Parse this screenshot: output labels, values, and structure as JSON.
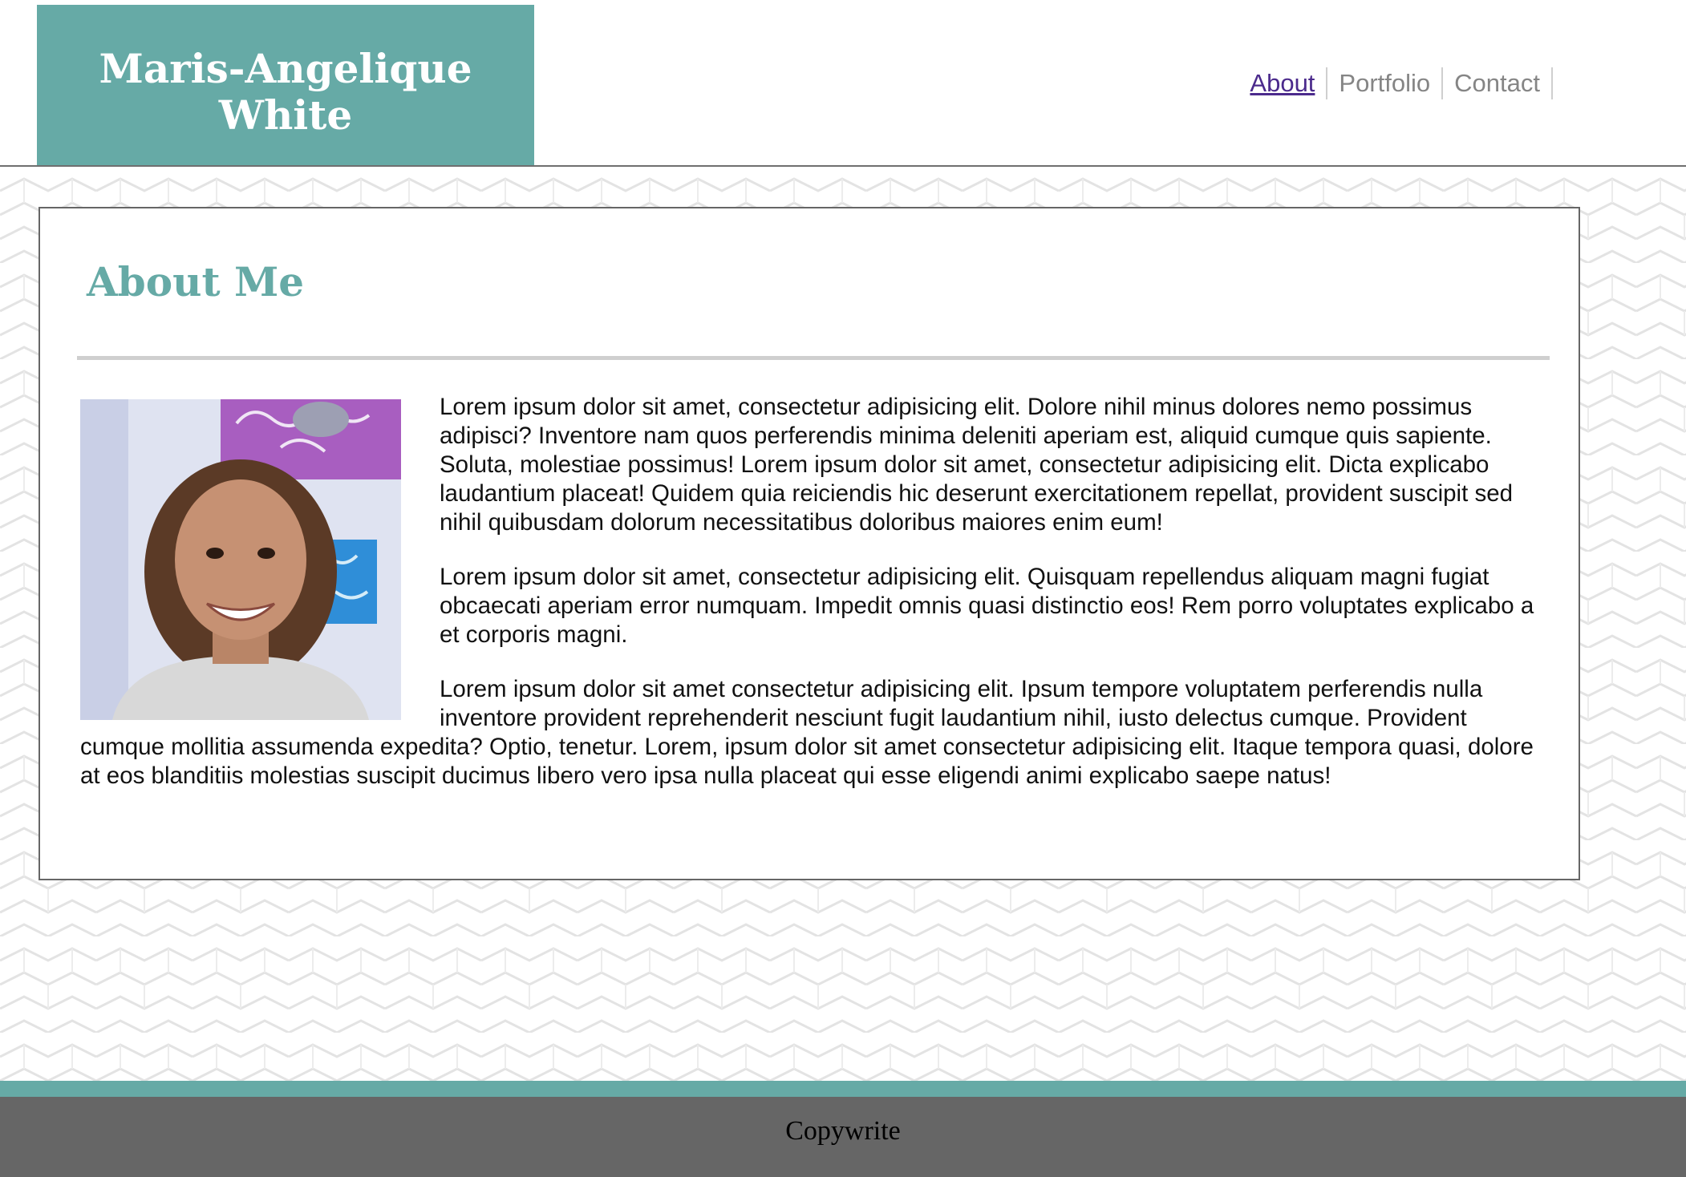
{
  "header": {
    "brand_line1": "Maris-Angelique",
    "brand_line2": "White",
    "nav": [
      {
        "label": "About",
        "active": true
      },
      {
        "label": "Portfolio",
        "active": false
      },
      {
        "label": "Contact",
        "active": false
      }
    ]
  },
  "main": {
    "title": "About Me",
    "paragraphs": [
      "Lorem ipsum dolor sit amet, consectetur adipisicing elit. Dolore nihil minus dolores nemo possimus adipisci? Inventore nam quos perferendis minima deleniti aperiam est, aliquid cumque quis sapiente. Soluta, molestiae possimus! Lorem ipsum dolor sit amet, consectetur adipisicing elit. Dicta explicabo laudantium placeat! Quidem quia reiciendis hic deserunt exercitationem repellat, provident suscipit sed nihil quibusdam dolorum necessitatibus doloribus maiores enim eum!",
      "Lorem ipsum dolor sit amet, consectetur adipisicing elit. Quisquam repellendus aliquam magni fugiat obcaecati aperiam error numquam. Impedit omnis quasi distinctio eos! Rem porro voluptates explicabo a et corporis magni.",
      "Lorem ipsum dolor sit amet consectetur adipisicing elit. Ipsum tempore voluptatem perferendis nulla inventore provident reprehenderit nesciunt fugit laudantium nihil, iusto delectus cumque. Provident cumque mollitia assumenda expedita? Optio, tenetur. Lorem, ipsum dolor sit amet consectetur adipisicing elit. Itaque tempora quasi, dolore at eos blanditiis molestias suscipit ducimus libero vero ipsa nulla placeat qui esse eligendi animi explicabo saepe natus!"
    ]
  },
  "footer": {
    "text": "Copywrite"
  },
  "colors": {
    "accent_teal": "#66aaa6",
    "footer_gray": "#666666",
    "nav_active": "#4b2a8c",
    "nav_inactive": "#858585"
  },
  "icons": {
    "profile_photo": "profile-photo"
  }
}
